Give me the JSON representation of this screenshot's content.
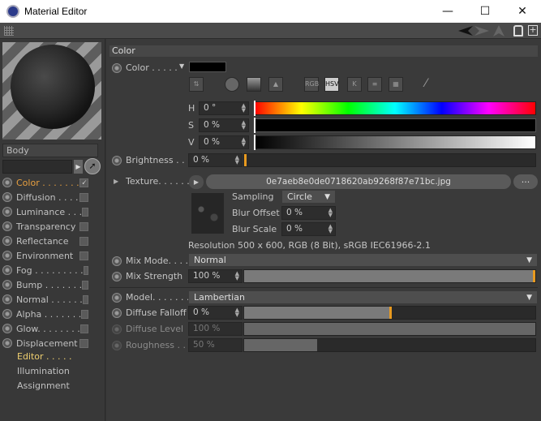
{
  "window": {
    "title": "Material Editor",
    "minimize": "—",
    "maximize": "☐",
    "close": "✕"
  },
  "left": {
    "material_name": "Body",
    "channels": [
      {
        "label": "Color . . . . . . .",
        "checked": "🗸",
        "active": true
      },
      {
        "label": "Diffusion . . . .",
        "checked": "",
        "active": false
      },
      {
        "label": "Luminance . . .",
        "checked": "",
        "active": false
      },
      {
        "label": "Transparency",
        "checked": "",
        "active": false
      },
      {
        "label": "Reflectance",
        "checked": "",
        "active": false
      },
      {
        "label": "Environment",
        "checked": "",
        "active": false
      },
      {
        "label": "Fog . . . . . . . . .",
        "checked": "",
        "active": false
      },
      {
        "label": "Bump . . . . . . .",
        "checked": "",
        "active": false
      },
      {
        "label": "Normal . . . . . .",
        "checked": "",
        "active": false
      },
      {
        "label": "Alpha . . . . . . .",
        "checked": "",
        "active": false
      },
      {
        "label": "Glow. . . . . . . .",
        "checked": "",
        "active": false
      },
      {
        "label": "Displacement",
        "checked": "",
        "active": false
      }
    ],
    "extra": [
      "Editor . . . . .",
      "Illumination",
      "Assignment"
    ]
  },
  "section": {
    "title": "Color"
  },
  "color": {
    "label": "Color . . . . .",
    "swatch": "#000000",
    "modes": [
      "RGB",
      "HSV",
      "K"
    ],
    "active_mode": "HSV",
    "h_label": "H",
    "h_value": "0 °",
    "s_label": "S",
    "s_value": "0 %",
    "v_label": "V",
    "v_value": "0 %"
  },
  "brightness": {
    "label": "Brightness . . .",
    "value": "0 %",
    "level": 0.0
  },
  "texture": {
    "label": "Texture. . . . . . .",
    "filename": "0e7aeb8e0de0718620ab9268f87e71bc.jpg",
    "more": "...",
    "sampling_label": "Sampling",
    "sampling_value": "Circle",
    "blur_offset_label": "Blur Offset",
    "blur_offset_value": "0 %",
    "blur_scale_label": "Blur Scale",
    "blur_scale_value": "0 %",
    "resolution": "Resolution 500 x 600, RGB (8 Bit), sRGB IEC61966-2.1"
  },
  "mix_mode": {
    "label": "Mix Mode. . . .",
    "value": "Normal"
  },
  "mix_strength": {
    "label": "Mix Strength",
    "value": "100 %",
    "level": 1.0
  },
  "model": {
    "label": "Model. . . . . . .",
    "value": "Lambertian"
  },
  "diffuse_falloff": {
    "label": "Diffuse Falloff",
    "value": "0 %",
    "level": 0.5
  },
  "diffuse_level": {
    "label": "Diffuse Level",
    "value": "100 %",
    "level": 1.0
  },
  "roughness": {
    "label": "Roughness . . .",
    "value": "50 %",
    "level": 0.25
  },
  "colors": {
    "accent": "#e89a20",
    "active_channel": "#e8a040"
  }
}
